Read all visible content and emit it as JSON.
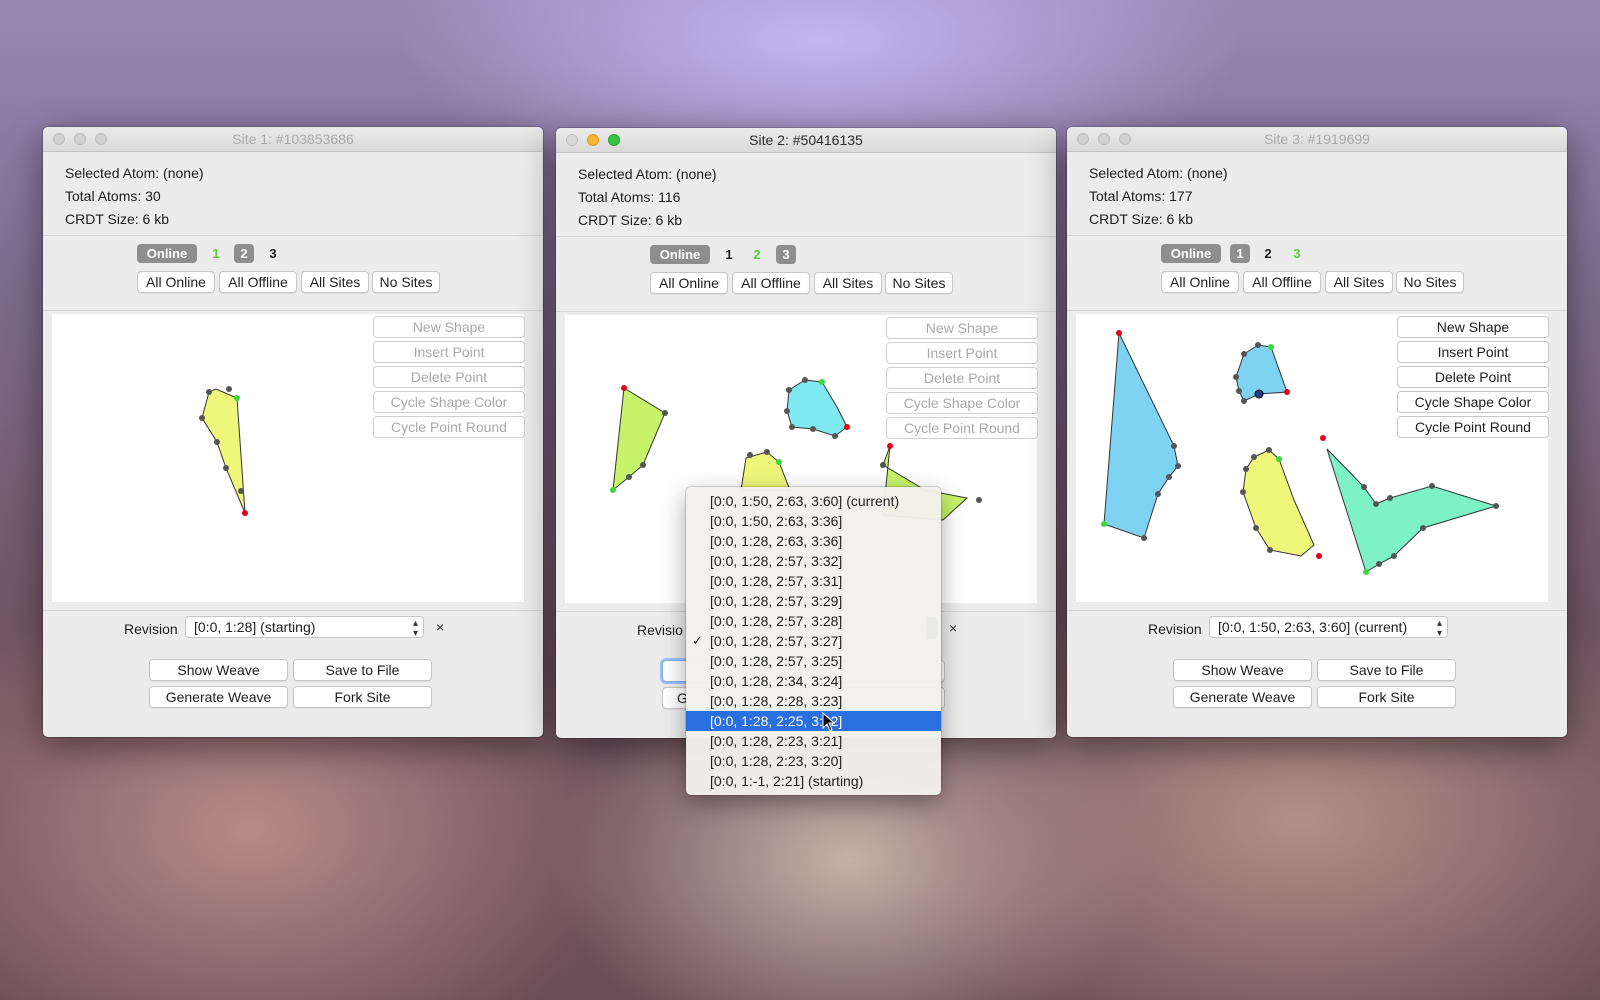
{
  "windows": [
    {
      "title": "Site 1: #103853686",
      "selected_atom": "Selected Atom: (none)",
      "total_atoms": "Total Atoms: 30",
      "crdt_size": "CRDT Size: 6 kb",
      "online_label": "Online",
      "site_chips": [
        "1",
        "2",
        "3"
      ],
      "site_buttons": [
        "All Online",
        "All Offline",
        "All Sites",
        "No Sites"
      ],
      "tools": [
        "New Shape",
        "Insert Point",
        "Delete Point",
        "Cycle Shape Color",
        "Cycle Point Round"
      ],
      "revision_label": "Revision",
      "revision_value": "[0:0, 1:28] (starting)",
      "revision_close": "×",
      "actions": [
        "Show Weave",
        "Save to File",
        "Generate Weave",
        "Fork Site"
      ]
    },
    {
      "title": "Site 2: #50416135",
      "selected_atom": "Selected Atom: (none)",
      "total_atoms": "Total Atoms: 116",
      "crdt_size": "CRDT Size: 6 kb",
      "online_label": "Online",
      "site_chips": [
        "1",
        "2",
        "3"
      ],
      "site_buttons": [
        "All Online",
        "All Offline",
        "All Sites",
        "No Sites"
      ],
      "tools": [
        "New Shape",
        "Insert Point",
        "Delete Point",
        "Cycle Shape Color",
        "Cycle Point Round"
      ],
      "revision_label": "Revisio",
      "revision_close": "×",
      "actions": [
        "",
        "",
        "G",
        ""
      ]
    },
    {
      "title": "Site 3: #1919699",
      "selected_atom": "Selected Atom: (none)",
      "total_atoms": "Total Atoms: 177",
      "crdt_size": "CRDT Size: 6 kb",
      "online_label": "Online",
      "site_chips": [
        "1",
        "2",
        "3"
      ],
      "site_buttons": [
        "All Online",
        "All Offline",
        "All Sites",
        "No Sites"
      ],
      "tools": [
        "New Shape",
        "Insert Point",
        "Delete Point",
        "Cycle Shape Color",
        "Cycle Point Round"
      ],
      "revision_label": "Revision",
      "revision_value": "[0:0, 1:50, 2:63, 3:60] (current)",
      "actions": [
        "Show Weave",
        "Save to File",
        "Generate Weave",
        "Fork Site"
      ]
    }
  ],
  "revision_dropdown": {
    "items": [
      "[0:0, 1:50, 2:63, 3:60] (current)",
      "[0:0, 1:50, 2:63, 3:36]",
      "[0:0, 1:28, 2:63, 3:36]",
      "[0:0, 1:28, 2:57, 3:32]",
      "[0:0, 1:28, 2:57, 3:31]",
      "[0:0, 1:28, 2:57, 3:29]",
      "[0:0, 1:28, 2:57, 3:28]",
      "[0:0, 1:28, 2:57, 3:27]",
      "[0:0, 1:28, 2:57, 3:25]",
      "[0:0, 1:28, 2:34, 3:24]",
      "[0:0, 1:28, 2:28, 3:23]",
      "[0:0, 1:28, 2:25, 3:22]",
      "[0:0, 1:28, 2:23, 3:21]",
      "[0:0, 1:28, 2:23, 3:20]",
      "[0:0, 1:-1, 2:21] (starting)"
    ],
    "checkmark": "✓",
    "checked_index": 7,
    "highlighted_index": 11
  },
  "colors": {
    "shape_yellow": "#eef77a",
    "shape_green": "#c7f36b",
    "shape_cyan": "#7fe9f2",
    "shape_blue": "#7fd3f2",
    "shape_teal": "#7ef2c7",
    "point_red": "#e0001b",
    "point_green": "#3bd83b",
    "point_gray": "#555555",
    "selection_blue": "#2a6fe0"
  }
}
